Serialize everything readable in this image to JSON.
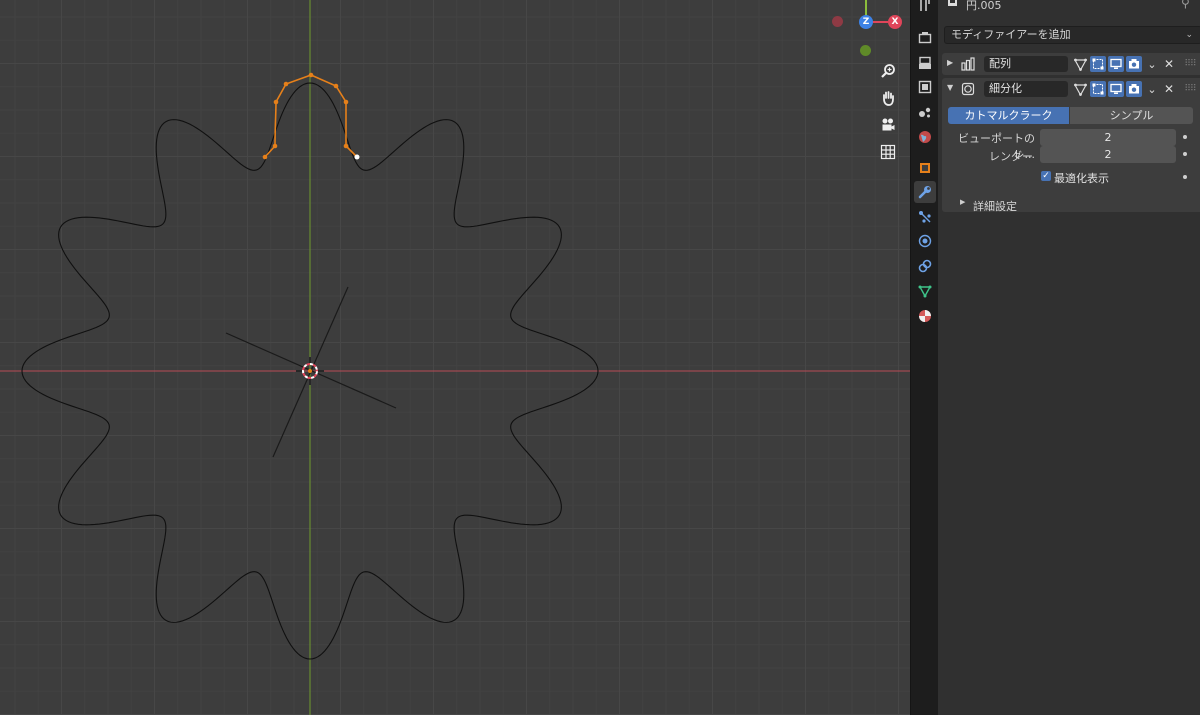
{
  "object_name": "円.005",
  "add_modifier_label": "モディファイアーを追加",
  "modifiers": [
    {
      "name": "配列"
    },
    {
      "name": "細分化"
    }
  ],
  "subdivision": {
    "mode_options": [
      "カトマルクラーク",
      "シンプル"
    ],
    "active_mode": "カトマルクラーク",
    "viewport_label": "ビューポートのレ...",
    "viewport_value": "2",
    "render_label": "レンダー",
    "render_value": "2",
    "optimal_display_label": "最適化表示",
    "optimal_display_checked": true,
    "advanced_label": "詳細設定"
  },
  "gizmo": {
    "z_label": "Z",
    "x_label": "X"
  },
  "colors": {
    "accent_blue": "#4772b3",
    "selection_orange": "#e6801a",
    "x_axis": "#e0455a",
    "y_axis": "#8cbd3c",
    "z_axis": "#3d82e6"
  },
  "icons": {
    "nav": [
      "zoom-icon",
      "hand-pan-icon",
      "camera-icon",
      "grid-icon"
    ],
    "tabs": [
      "tool-icon",
      "render-icon",
      "output-icon",
      "view-layer-icon",
      "scene-icon",
      "world-icon",
      "object-icon",
      "modifier-wrench-icon",
      "particles-icon",
      "physics-icon",
      "constraints-icon",
      "data-icon",
      "material-icon"
    ]
  }
}
